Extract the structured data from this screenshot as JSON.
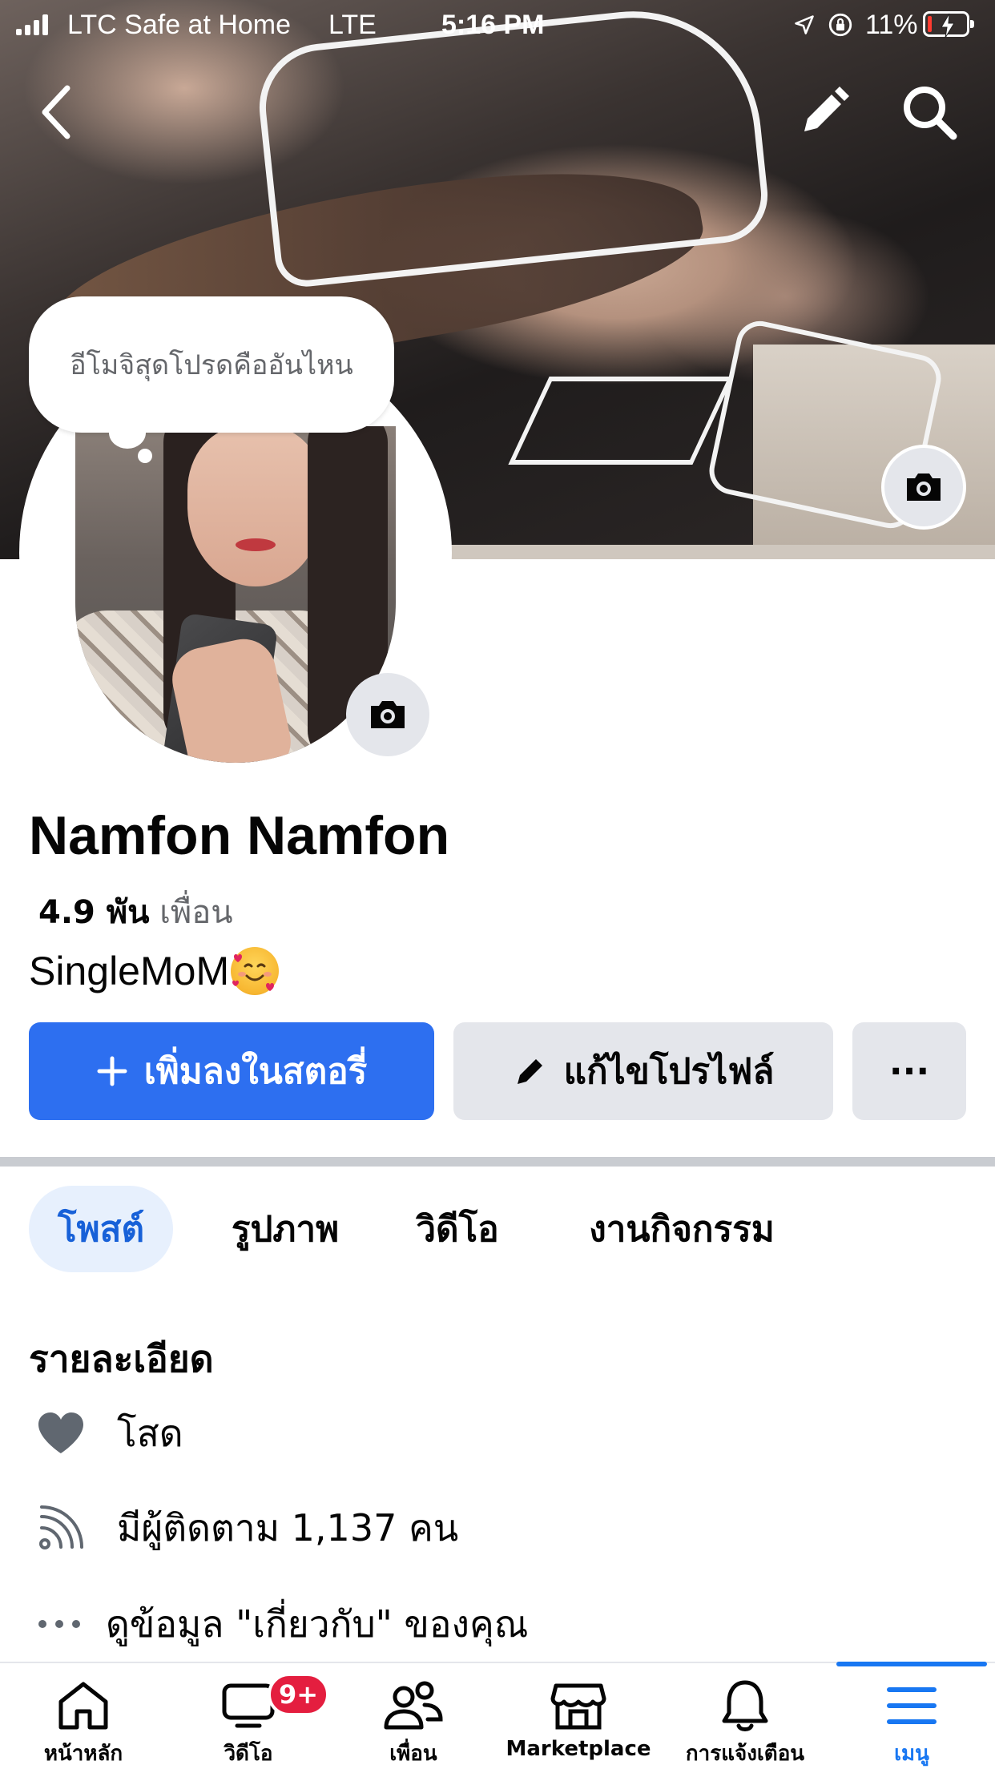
{
  "status_bar": {
    "carrier": "LTC Safe at Home",
    "network": "LTE",
    "time": "5:16 PM",
    "battery_percent": "11%",
    "battery_level": 0.11,
    "battery_color": "#ff3b30"
  },
  "header": {
    "back_icon": "chevron-left-icon",
    "edit_icon": "pencil-icon",
    "search_icon": "search-icon",
    "cover_camera_icon": "camera-icon"
  },
  "note": {
    "text": "อีโมจิสุดโปรดคืออันไหน"
  },
  "profile": {
    "name": "Namfon Namfon",
    "friends_count": "4.9 พัน",
    "friends_label": "เพื่อน",
    "bio": "SingleMoM",
    "bio_emoji": "smiling-face-with-hearts"
  },
  "actions": {
    "add_story": "เพิ่มลงในสตอรี่",
    "edit_profile": "แก้ไขโปรไฟล์",
    "more": "···",
    "accent_color": "#1877f2"
  },
  "tabs": [
    {
      "label": "โพสต์",
      "active": true
    },
    {
      "label": "รูปภาพ",
      "active": false
    },
    {
      "label": "วิดีโอ",
      "active": false
    },
    {
      "label": "งานกิจกรรม",
      "active": false
    }
  ],
  "details": {
    "heading": "รายละเอียด",
    "items": [
      {
        "icon": "heart-icon",
        "text": "โสด"
      },
      {
        "icon": "rss-icon",
        "text": "มีผู้ติดตาม 1,137 คน"
      },
      {
        "icon": "more-dots-icon",
        "text": "ดูข้อมูล \"เกี่ยวกับ\" ของคุณ"
      }
    ]
  },
  "bottom_nav": [
    {
      "icon": "home-icon",
      "label": "หน้าหลัก"
    },
    {
      "icon": "video-icon",
      "label": "วิดีโอ",
      "badge": "9+"
    },
    {
      "icon": "friends-icon",
      "label": "เพื่อน"
    },
    {
      "icon": "marketplace-icon",
      "label": "Marketplace"
    },
    {
      "icon": "bell-icon",
      "label": "การแจ้งเตือน"
    },
    {
      "icon": "menu-icon",
      "label": "เมนู",
      "active": true
    }
  ]
}
